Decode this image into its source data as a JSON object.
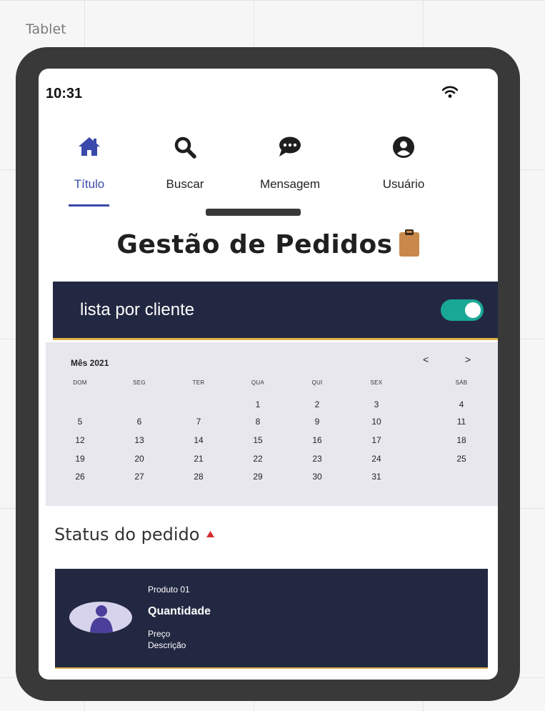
{
  "canvas": {
    "label": "Tablet"
  },
  "status_bar": {
    "time": "10:31",
    "wifi_icon": "wifi-icon"
  },
  "nav": {
    "tabs": [
      {
        "label": "Título",
        "icon": "home-icon",
        "active": true
      },
      {
        "label": "Buscar",
        "icon": "search-icon",
        "active": false
      },
      {
        "label": "Mensagem",
        "icon": "message-icon",
        "active": false
      },
      {
        "label": "Usuário",
        "icon": "user-icon",
        "active": false
      }
    ]
  },
  "page": {
    "title": "Gestão de Pedidos",
    "title_icon": "clipboard-icon"
  },
  "toggle": {
    "label": "lista por cliente",
    "on": true
  },
  "calendar": {
    "month_label": "Mês 2021",
    "prev": "<",
    "next": ">",
    "weekdays": [
      "DOM",
      "SEG",
      "TER",
      "QUA",
      "QUI",
      "SEX",
      "SÁB"
    ],
    "weeks": [
      [
        "",
        "",
        "",
        "1",
        "2",
        "3",
        "4"
      ],
      [
        "5",
        "6",
        "7",
        "8",
        "9",
        "10",
        "11"
      ],
      [
        "12",
        "13",
        "14",
        "15",
        "16",
        "17",
        "18"
      ],
      [
        "19",
        "20",
        "21",
        "22",
        "23",
        "24",
        "25"
      ],
      [
        "26",
        "27",
        "28",
        "29",
        "30",
        "31",
        ""
      ]
    ]
  },
  "status_section": {
    "heading": "Status do pedido",
    "caret_icon": "caret-up-icon"
  },
  "order_card": {
    "product": "Produto 01",
    "quantity": "Quantidade",
    "price": "Preço",
    "description": "Descrição",
    "avatar_icon": "user-avatar-icon"
  },
  "colors": {
    "accent": "#3949ab",
    "navy": "#232842",
    "toggle_on": "#1aa896",
    "gold": "#e0b24a",
    "clipboard": "#c8894a",
    "caret": "#d32f2f",
    "calendar_bg": "#e9e7ee",
    "frame": "#393939"
  }
}
